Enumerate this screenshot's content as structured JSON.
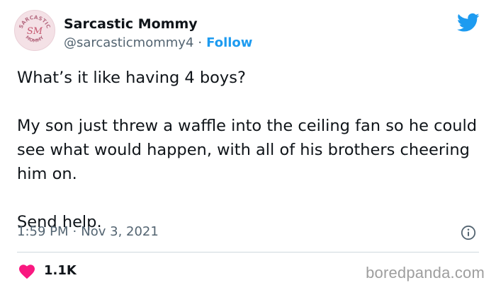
{
  "author": {
    "display_name": "Sarcastic Mommy",
    "handle": "@sarcasticmommy4",
    "separator": "·",
    "follow_label": "Follow",
    "avatar_top_text": "SARCASTIC",
    "avatar_initials": "SM",
    "avatar_bottom_text": "MOMMY"
  },
  "tweet": {
    "paragraphs": [
      "What’s it like having 4 boys?",
      "My son just threw a waffle into the ceiling fan so he could see what would happen, with all of his brothers cheering him on.",
      "Send help."
    ]
  },
  "meta": {
    "time": "1:59 PM",
    "separator": "·",
    "date": "Nov 3, 2021"
  },
  "engagement": {
    "likes": "1.1K"
  },
  "watermark": "boredpanda.com",
  "colors": {
    "twitter_blue": "#1d9bf0",
    "like_red": "#f91880",
    "secondary_text": "#536471"
  },
  "icons": {
    "brand": "twitter-bird-icon",
    "info": "info-icon",
    "like": "heart-icon"
  }
}
